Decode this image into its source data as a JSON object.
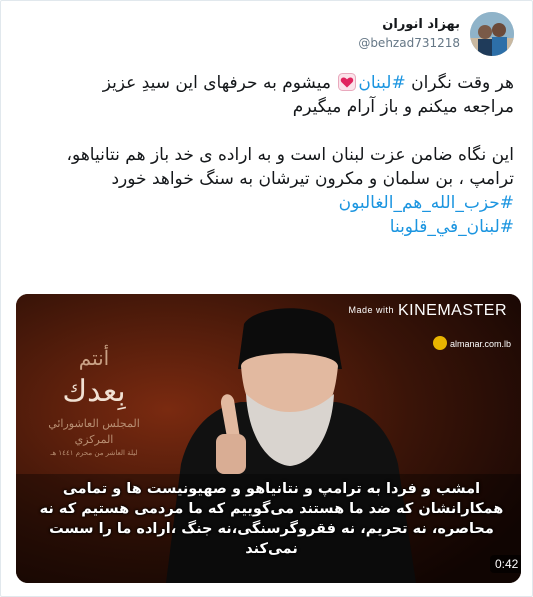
{
  "user": {
    "display_name": "بهزاد انوران",
    "handle": "@behzad731218"
  },
  "tweet": {
    "line1_a": "هر وقت نگران ",
    "hashtag_inline": "#لبنان",
    "line1_b": " میشوم به حرفهای این سیدِ عزیز",
    "line2": "مراجعه میکنم و باز آرام میگیرم",
    "para2": "این نگاه ضامن عزت لبنان است و به اراده ی خد باز هم نتانیاهو، ترامپ ، بن سلمان و مکرون تیرشان به سنگ خواهد خورد",
    "hashtag1": "#حزب_الله_هم_الغالبون",
    "hashtag2": "#لبنان_في_قلوبنا",
    "heart_icon": "heart-emoji",
    "link_color": "#1b95e0"
  },
  "media": {
    "watermark_small": "Made with",
    "watermark_brand": "KINEMASTER",
    "channel": "almanar.com.lb",
    "poster_line1": "أنتم",
    "poster_line2": "بِعدك",
    "poster_line3": "المجلس العاشورائي المركزي",
    "poster_line4": "ليلة العاشر من محرم ١٤٤١ هـ",
    "subtitle": "امشب و فردا به ترامپ و نتانیاهو و صهیونیست ها و تمامی همکارانشان که ضد ما هستند می‌گوییم که ما مردمی هستیم که نه محاصره، نه تحریم، نه فقروگرسنگی،نه جنگ ،اراده ما را سست نمی‌کند",
    "duration": "0:42"
  }
}
